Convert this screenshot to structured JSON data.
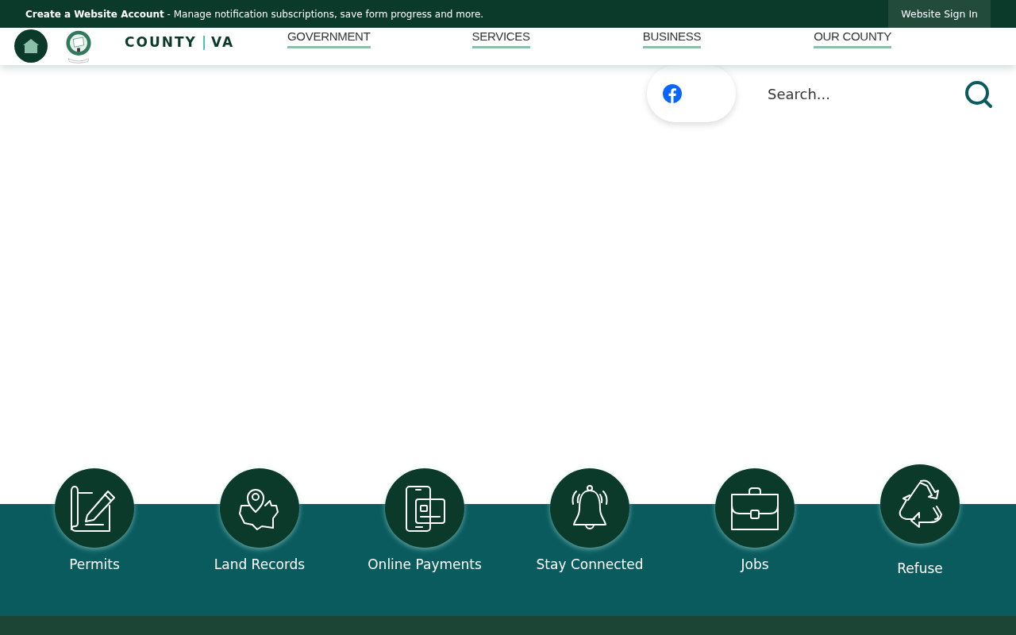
{
  "top_bar": {
    "account_link": "Create a Website Account",
    "message": " - Manage notification subscriptions, save form progress and more.",
    "sign_in": "Website Sign In"
  },
  "logo": {
    "county": "COUNTY",
    "separator": "|",
    "state": "VA"
  },
  "nav": [
    {
      "label": "GOVERNMENT"
    },
    {
      "label": "SERVICES"
    },
    {
      "label": "BUSINESS"
    },
    {
      "label": "OUR COUNTY"
    }
  ],
  "search": {
    "placeholder": "Search..."
  },
  "quick_links": [
    {
      "label": "Permits",
      "kind": "permit"
    },
    {
      "label": "Land Records",
      "kind": "map"
    },
    {
      "label": "Online Payments",
      "kind": "payment"
    },
    {
      "label": "Stay Connected",
      "kind": "bell"
    },
    {
      "label": "Jobs",
      "kind": "briefcase"
    },
    {
      "label": "Refuse",
      "kind": "recycle"
    }
  ]
}
